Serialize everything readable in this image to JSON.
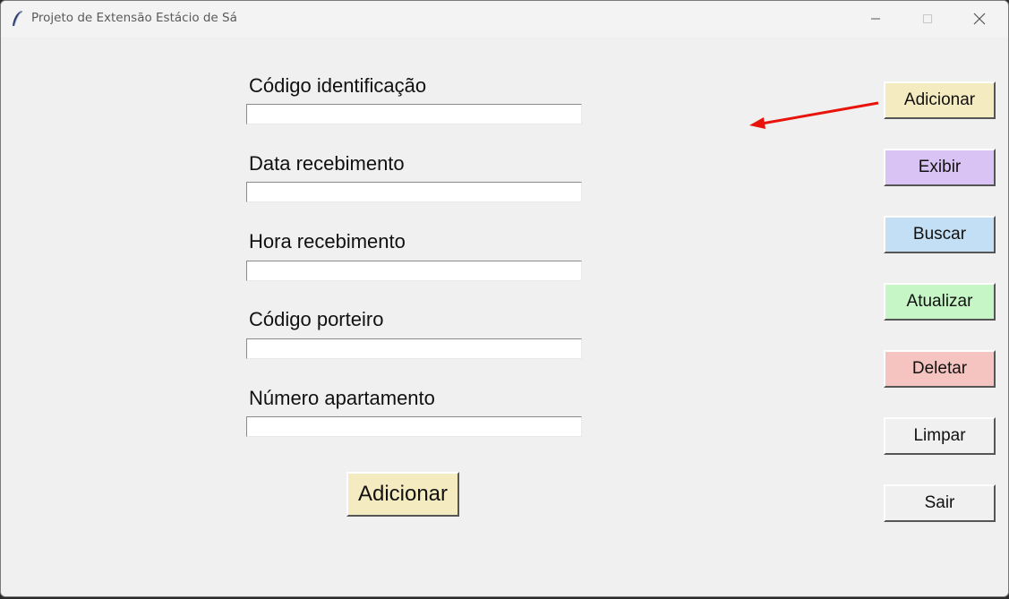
{
  "window": {
    "title": "Projeto de Extensão Estácio de Sá"
  },
  "form": {
    "fields": [
      {
        "label": "Código identificação",
        "value": ""
      },
      {
        "label": "Data recebimento",
        "value": ""
      },
      {
        "label": "Hora recebimento",
        "value": ""
      },
      {
        "label": "Código porteiro",
        "value": ""
      },
      {
        "label": "Número apartamento",
        "value": ""
      }
    ],
    "submit_label": "Adicionar",
    "submit_color": "#f5ebc0"
  },
  "sidebar": {
    "buttons": [
      {
        "label": "Adicionar",
        "color": "#f5ebc0"
      },
      {
        "label": "Exibir",
        "color": "#d9c3f5"
      },
      {
        "label": "Buscar",
        "color": "#c2dff5"
      },
      {
        "label": "Atualizar",
        "color": "#c6f5c6"
      },
      {
        "label": "Deletar",
        "color": "#f5c4c0"
      },
      {
        "label": "Limpar",
        "color": "#f0f0f0"
      },
      {
        "label": "Sair",
        "color": "#f0f0f0"
      }
    ]
  },
  "annotation": {
    "icon": "red-arrow-icon",
    "color": "#e8140c"
  }
}
